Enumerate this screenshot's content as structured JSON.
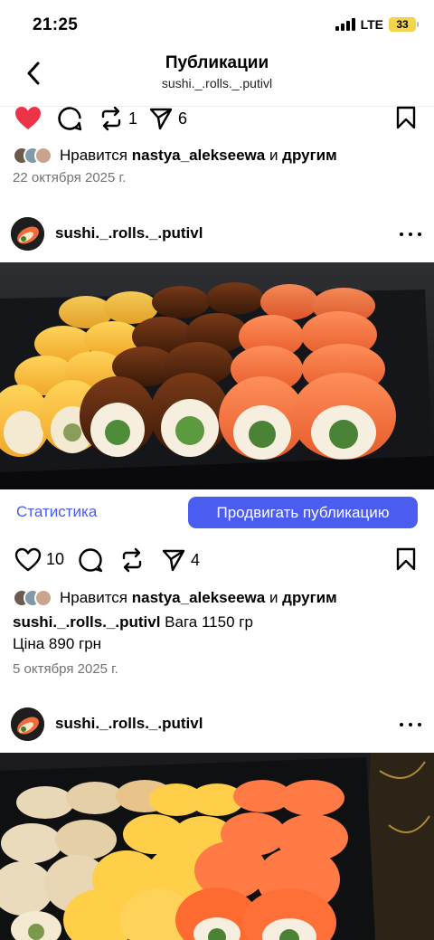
{
  "status": {
    "time": "21:25",
    "network": "LTE",
    "battery": "33"
  },
  "nav": {
    "title": "Публикации",
    "subtitle": "sushi._.rolls._.putivl"
  },
  "post1": {
    "reposts": "1",
    "shares": "6",
    "likes_prefix": "Нравится",
    "likes_user": "nastya_alekseewa",
    "likes_and": "и",
    "likes_others": "другим",
    "date": "22 октября 2025 г."
  },
  "post2": {
    "username": "sushi._.rolls._.putivl",
    "statistics_label": "Статистика",
    "promote_label": "Продвигать публикацию",
    "likes": "10",
    "shares": "4",
    "likes_prefix": "Нравится",
    "likes_user": "nastya_alekseewa",
    "likes_and": "и",
    "likes_others": "другим",
    "caption_user": "sushi._.rolls._.putivl",
    "caption_line1": "Вага 1150 гр",
    "caption_line2": "Ціна 890 грн",
    "date": "5 октября 2025 г."
  },
  "post3": {
    "username": "sushi._.rolls._.putivl"
  },
  "colors": {
    "accent": "#4a5df0",
    "like": "#ed3348",
    "battery": "#f2d54b",
    "muted": "#737373"
  }
}
